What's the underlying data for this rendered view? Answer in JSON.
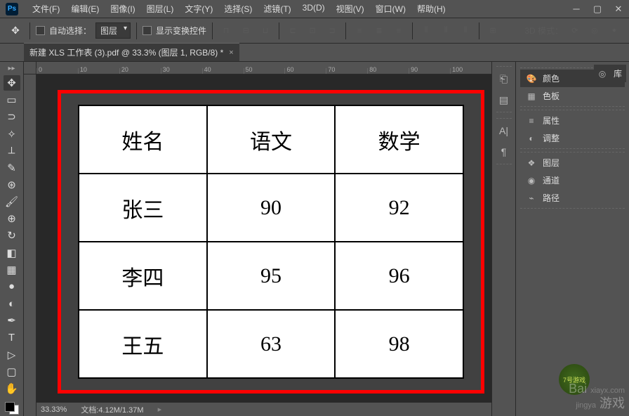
{
  "menubar": [
    "文件(F)",
    "编辑(E)",
    "图像(I)",
    "图层(L)",
    "文字(Y)",
    "选择(S)",
    "滤镜(T)",
    "3D(D)",
    "视图(V)",
    "窗口(W)",
    "帮助(H)"
  ],
  "options": {
    "auto_select": "自动选择：",
    "target": "图层",
    "show_transform": "显示变换控件",
    "mode3d": "3D 模式："
  },
  "tab": {
    "title": "新建 XLS 工作表 (3).pdf @ 33.3% (图层 1, RGB/8) *",
    "close": "×"
  },
  "ruler_h": [
    "0",
    "10",
    "20",
    "30",
    "40",
    "50",
    "60",
    "70",
    "80",
    "90",
    "100"
  ],
  "chart_data": {
    "type": "table",
    "headers": [
      "姓名",
      "语文",
      "数学"
    ],
    "rows": [
      [
        "张三",
        "90",
        "92"
      ],
      [
        "李四",
        "95",
        "96"
      ],
      [
        "王五",
        "63",
        "98"
      ]
    ]
  },
  "status": {
    "zoom": "33.33%",
    "doc": "文档:4.12M/1.37M"
  },
  "panels": {
    "color": "颜色",
    "swatches": "色板",
    "library": "库",
    "properties": "属性",
    "adjustments": "调整",
    "layers": "图层",
    "channels": "通道",
    "paths": "路径"
  },
  "watermark": {
    "line1": "Bai",
    "line2": "游戏",
    "small": "jingya",
    "site": "xiayx.com",
    "logo": "7号游戏"
  }
}
